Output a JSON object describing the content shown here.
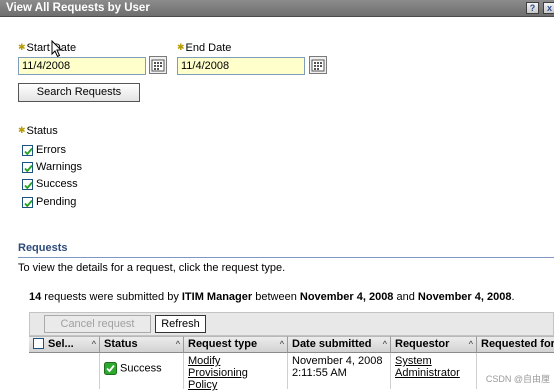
{
  "titlebar": {
    "title": "View All Requests by User",
    "help_icon": "?",
    "close_icon": "x"
  },
  "form": {
    "start_date_label": "Start Date",
    "start_date_value": "11/4/2008",
    "end_date_label": "End Date",
    "end_date_value": "11/4/2008",
    "search_button": "Search Requests",
    "status_label": "Status",
    "status_options": [
      {
        "label": "Errors",
        "checked": true
      },
      {
        "label": "Warnings",
        "checked": true
      },
      {
        "label": "Success",
        "checked": true
      },
      {
        "label": "Pending",
        "checked": true
      }
    ]
  },
  "requests": {
    "heading": "Requests",
    "hint": "To view the details for a request, click the request type.",
    "summary": {
      "count": "14",
      "text1": " requests were submitted by ",
      "user": "ITIM Manager",
      "text2": " between ",
      "start": "November 4, 2008",
      "text3": " and ",
      "end": "November 4, 2008",
      "text4": "."
    },
    "toolbar": {
      "cancel_label": "Cancel request",
      "refresh_label": "Refresh"
    },
    "columns": [
      "Sel...",
      "Status",
      "Request type",
      "Date submitted",
      "Requestor",
      "Requested for"
    ],
    "rows": [
      {
        "status": "Success",
        "request_type_line1": "Modify Provisioning",
        "request_type_line2": "Policy",
        "date_line1": "November 4, 2008",
        "date_line2": "2:11:55 AM",
        "requestor_line1": "System",
        "requestor_line2": "Administrator",
        "requested_for": ""
      }
    ]
  },
  "watermark": "CSDN @自由厘",
  "colors": {
    "required_marker": "#b79b00",
    "date_field_bg": "#ffffcc",
    "section_heading": "#2e4a7a"
  }
}
